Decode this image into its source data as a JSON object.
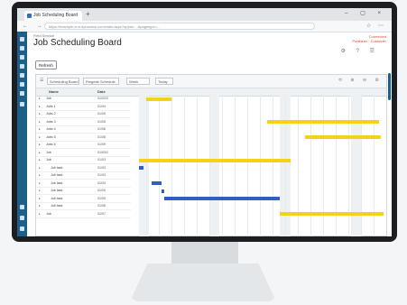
{
  "browser": {
    "tab_title": "Job Scheduling Board",
    "new_tab": "+",
    "window_controls": "– ▢ ×",
    "nav_buttons": "← → ⟳",
    "url": "https://example.crm.dynamics.com/main.aspx?appid=...&pagetype=...",
    "addr_icons": "☆ ⋯"
  },
  "page": {
    "breadcrumb": "Field Service",
    "title": "Job Scheduling Board",
    "topright_line1": "Connected",
    "topright_line2": "Publisher · Customer",
    "topright_icons": "⚙ ? ☰",
    "action_button": "Refresh"
  },
  "toolbar": {
    "dropdowns": [
      {
        "label": "Scheduling Board"
      },
      {
        "label": "Ringette Schedule"
      },
      {
        "label": "Week"
      },
      {
        "label": "Today"
      }
    ],
    "left_icon": "☰",
    "right_icons": "⟲ ⊕ ⊖ ⚙"
  },
  "grid": {
    "headers": {
      "name": "Name",
      "value": "Date"
    },
    "rows": [
      {
        "name": "Job",
        "value": "01/02/2",
        "indent": 1
      },
      {
        "name": "Jobs 1",
        "value": "01/04",
        "indent": 1
      },
      {
        "name": "Jobs 2",
        "value": "01/05",
        "indent": 1
      },
      {
        "name": "Jobs 3",
        "value": "01/05",
        "indent": 1
      },
      {
        "name": "Jobs 4",
        "value": "01/06",
        "indent": 1
      },
      {
        "name": "Jobs 5",
        "value": "01/08",
        "indent": 1
      },
      {
        "name": "Jobs 6",
        "value": "01/09",
        "indent": 1
      },
      {
        "name": "Job",
        "value": "01/03/2",
        "indent": 1
      },
      {
        "name": "Job",
        "value": "01/03",
        "indent": 1
      },
      {
        "name": "Job task",
        "value": "01/03",
        "indent": 2
      },
      {
        "name": "Job task",
        "value": "01/03",
        "indent": 2
      },
      {
        "name": "Job task",
        "value": "01/04",
        "indent": 2
      },
      {
        "name": "Job task",
        "value": "01/05",
        "indent": 2
      },
      {
        "name": "Job task",
        "value": "01/05",
        "indent": 2
      },
      {
        "name": "Job task",
        "value": "01/06",
        "indent": 2
      },
      {
        "name": "Job",
        "value": "01/07",
        "indent": 1
      }
    ]
  },
  "gantt_bars": [
    {
      "row": 0,
      "start": 0.05,
      "end": 0.15,
      "color": "#f2d21b"
    },
    {
      "row": 3,
      "start": 0.53,
      "end": 0.97,
      "color": "#f2d21b"
    },
    {
      "row": 5,
      "start": 0.68,
      "end": 0.98,
      "color": "#f2d21b"
    },
    {
      "row": 8,
      "start": 0.02,
      "end": 0.62,
      "color": "#f2d21b"
    },
    {
      "row": 9,
      "start": 0.02,
      "end": 0.04,
      "color": "#2f5fc4"
    },
    {
      "row": 11,
      "start": 0.07,
      "end": 0.11,
      "color": "#2f5fc4"
    },
    {
      "row": 12,
      "start": 0.11,
      "end": 0.12,
      "color": "#2f5fc4"
    },
    {
      "row": 13,
      "start": 0.12,
      "end": 0.58,
      "color": "#2f5fc4"
    },
    {
      "row": 15,
      "start": 0.58,
      "end": 0.99,
      "color": "#f2d21b"
    }
  ],
  "colors": {
    "nav": "#1c5f88",
    "accent_red": "#d8462c",
    "bar_yellow": "#f2d21b",
    "bar_blue": "#2f5fc4"
  }
}
